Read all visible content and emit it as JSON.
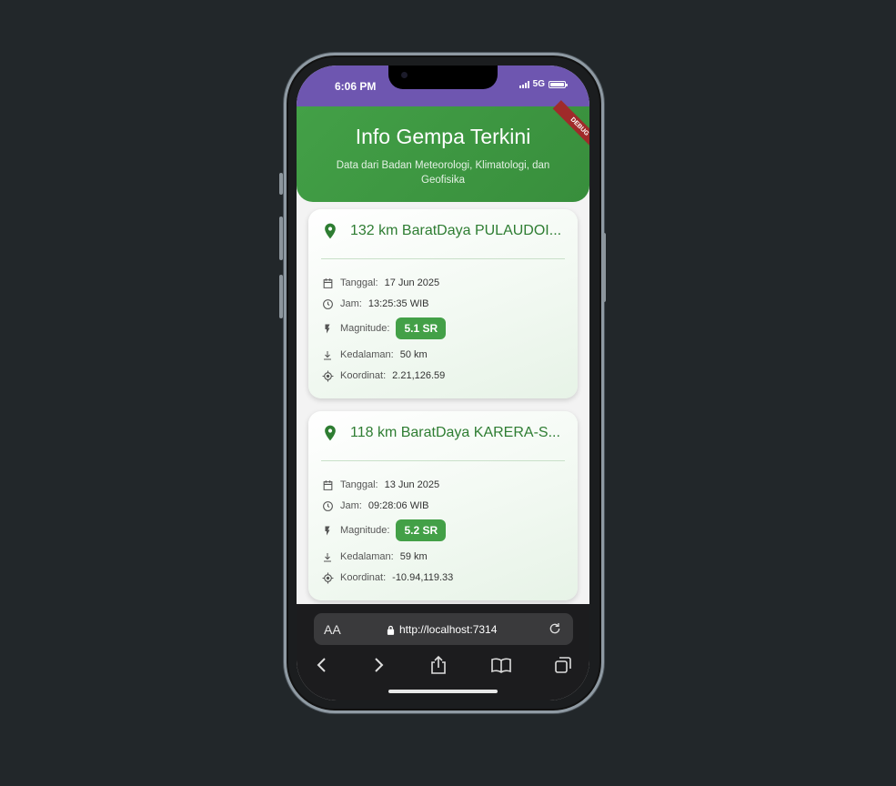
{
  "status_bar": {
    "time": "6:06 PM",
    "network": "5G"
  },
  "header": {
    "title": "Info Gempa Terkini",
    "subtitle": "Data dari Badan Meteorologi, Klimatologi, dan Geofisika",
    "debug_label": "DEBUG"
  },
  "labels": {
    "date": "Tanggal:",
    "time": "Jam:",
    "magnitude": "Magnitude:",
    "depth": "Kedalaman:",
    "coordinates": "Koordinat:"
  },
  "quakes": [
    {
      "location": "132 km BaratDaya PULAUDOI...",
      "date": "17 Jun 2025",
      "time": "13:25:35 WIB",
      "magnitude": "5.1 SR",
      "depth": "50 km",
      "coordinates": "2.21,126.59"
    },
    {
      "location": "118 km BaratDaya KARERA-S...",
      "date": "13 Jun 2025",
      "time": "09:28:06 WIB",
      "magnitude": "5.2 SR",
      "depth": "59 km",
      "coordinates": "-10.94,119.33"
    }
  ],
  "browser": {
    "aa_label": "AA",
    "url": "http://localhost:7314"
  },
  "colors": {
    "primary_green": "#43a047",
    "title_green": "#2e7d32",
    "status_purple": "#6e56b0",
    "debug_red": "#a02a2a"
  },
  "icons": [
    "location-pin-icon",
    "calendar-icon",
    "clock-icon",
    "flash-icon",
    "depth-icon",
    "gps-target-icon",
    "lock-icon",
    "reload-icon",
    "back-icon",
    "forward-icon",
    "share-icon",
    "bookmarks-icon",
    "tabs-icon"
  ]
}
